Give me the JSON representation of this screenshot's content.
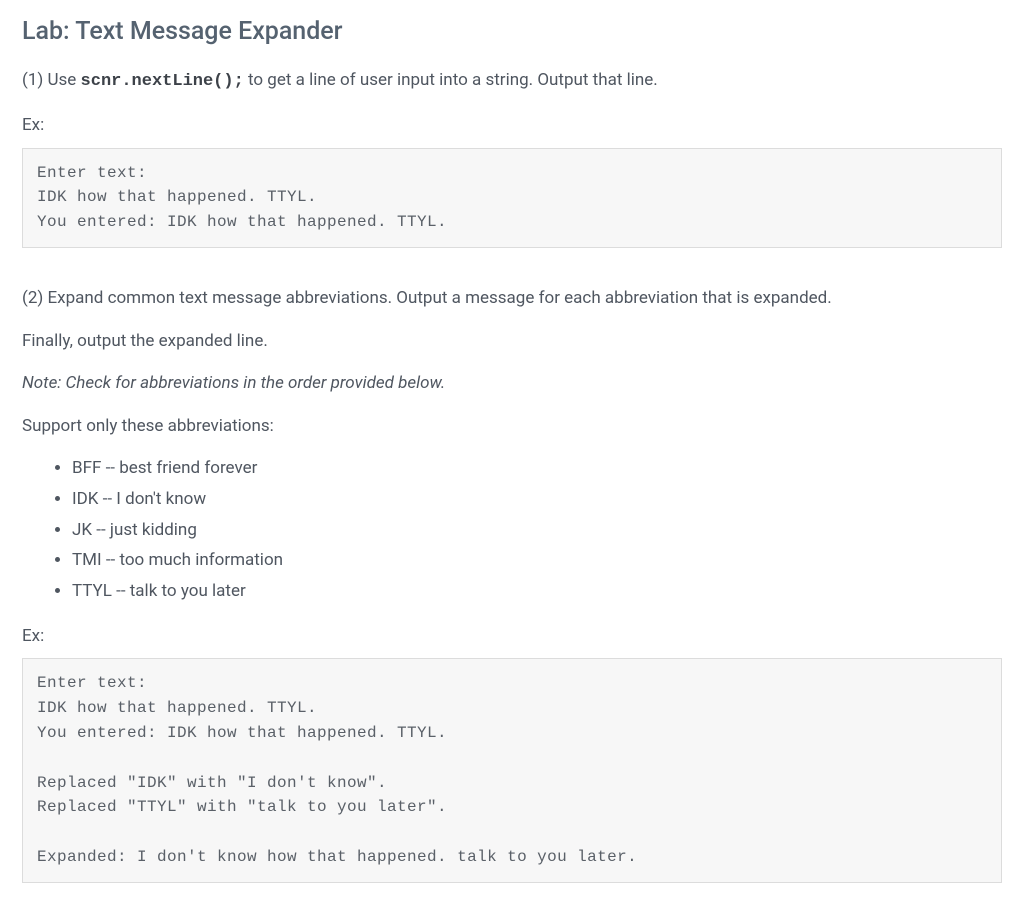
{
  "title": "Lab: Text Message Expander",
  "step1": {
    "pre": "(1) Use ",
    "code": "scnr.nextLine();",
    "post": " to get a line of user input into a string. Output that line."
  },
  "ex_label": "Ex:",
  "codeblock1": "Enter text:\nIDK how that happened. TTYL.\nYou entered: IDK how that happened. TTYL.",
  "step2_line1": "(2) Expand common text message abbreviations. Output a message for each abbreviation that is expanded.",
  "step2_line2": "Finally, output the expanded line.",
  "note": "Note: Check for abbreviations in the order provided below.",
  "support_label": "Support only these abbreviations:",
  "abbreviations": [
    "BFF -- best friend forever",
    "IDK -- I don't know",
    "JK -- just kidding",
    "TMI -- too much information",
    "TTYL -- talk to you later"
  ],
  "codeblock2": "Enter text:\nIDK how that happened. TTYL.\nYou entered: IDK how that happened. TTYL.\n\nReplaced \"IDK\" with \"I don't know\".\nReplaced \"TTYL\" with \"talk to you later\".\n\nExpanded: I don't know how that happened. talk to you later."
}
